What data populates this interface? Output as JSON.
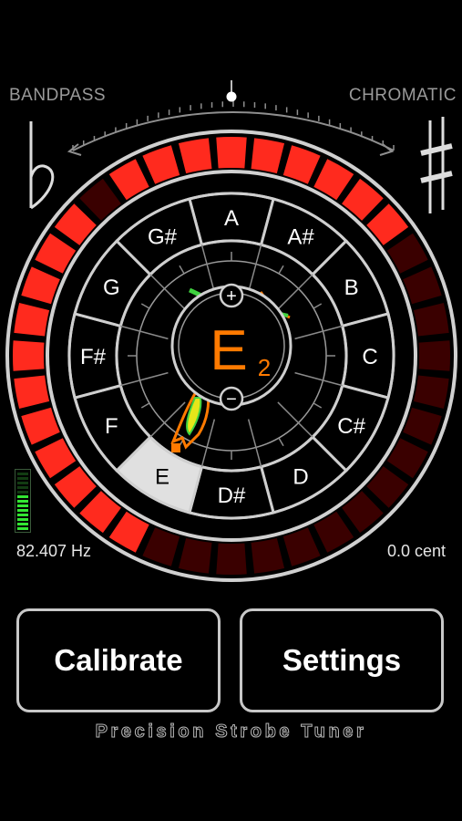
{
  "modes": {
    "left": "BANDPASS",
    "right": "CHROMATIC"
  },
  "notes": [
    {
      "name": "A"
    },
    {
      "name": "A#"
    },
    {
      "name": "B"
    },
    {
      "name": "C"
    },
    {
      "name": "C#"
    },
    {
      "name": "D"
    },
    {
      "name": "D#"
    },
    {
      "name": "E"
    },
    {
      "name": "F"
    },
    {
      "name": "F#"
    },
    {
      "name": "G"
    },
    {
      "name": "G#"
    }
  ],
  "selected_note": "E",
  "current_note": {
    "letter": "E",
    "octave": "2"
  },
  "fine_tune": {
    "plus": "+",
    "minus": "−"
  },
  "readouts": {
    "frequency": "82.407 Hz",
    "cents": "0.0 cent"
  },
  "input_level": 0.6,
  "strobe_lit_top": [
    1,
    2,
    3,
    4,
    5,
    6,
    7,
    8,
    9
  ],
  "strobe_lit_bottom": [
    25,
    26,
    27,
    28,
    29,
    30,
    31,
    32,
    33,
    34,
    35
  ],
  "buttons": {
    "calibrate": "Calibrate",
    "settings": "Settings"
  },
  "app_title": "Precision Strobe Tuner",
  "colors": {
    "strobe_on": "#ff2a1e",
    "strobe_off": "#3a0000",
    "note_accent": "#ff7a00",
    "selected_cell": "#e0e0e0"
  }
}
